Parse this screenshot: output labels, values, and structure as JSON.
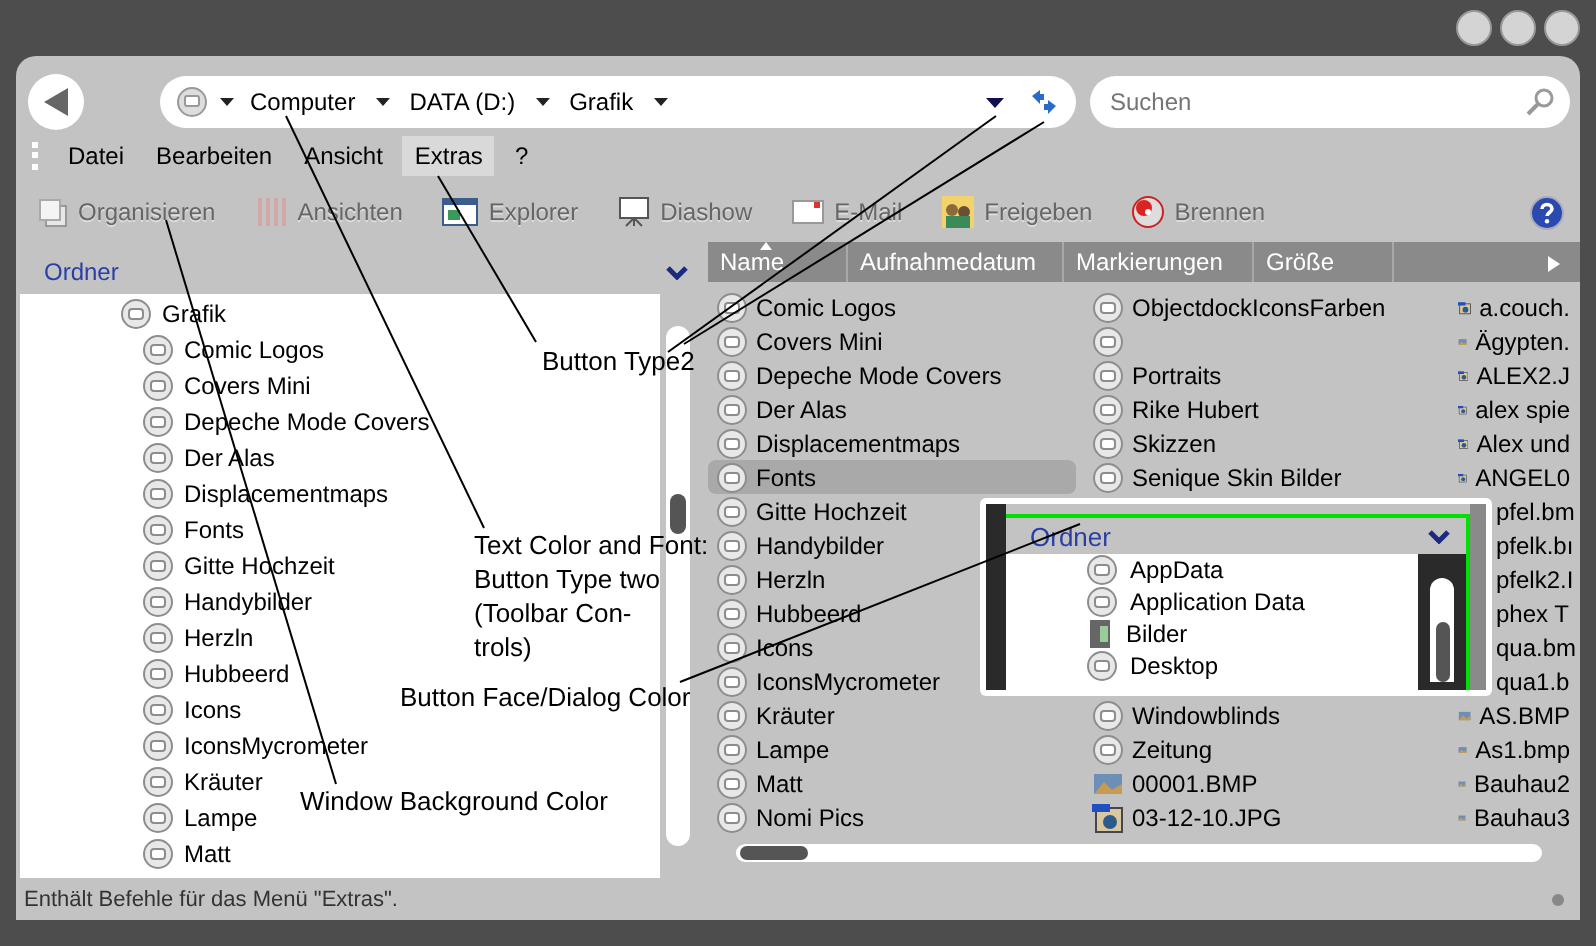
{
  "address_bar": {
    "breadcrumbs": [
      "Computer",
      "DATA (D:)",
      "Grafik"
    ]
  },
  "search": {
    "placeholder": "Suchen"
  },
  "menu": [
    {
      "label": "Datei",
      "selected": false
    },
    {
      "label": "Bearbeiten",
      "selected": false
    },
    {
      "label": "Ansicht",
      "selected": false
    },
    {
      "label": "Extras",
      "selected": true
    },
    {
      "label": "?",
      "selected": false
    }
  ],
  "toolbar": [
    {
      "label": "Organisieren",
      "kind": "organize",
      "disabled": true
    },
    {
      "label": "Ansichten",
      "kind": "views",
      "disabled": true
    },
    {
      "label": "Explorer",
      "kind": "explorer",
      "disabled": true
    },
    {
      "label": "Diashow",
      "kind": "slideshow",
      "disabled": true
    },
    {
      "label": "E-Mail",
      "kind": "email",
      "disabled": true
    },
    {
      "label": "Freigeben",
      "kind": "share",
      "disabled": true
    },
    {
      "label": "Brennen",
      "kind": "burn",
      "disabled": true
    }
  ],
  "folder_pane": {
    "title": "Ordner",
    "tree": [
      {
        "label": "Grafik",
        "children": [
          {
            "label": "Comic Logos"
          },
          {
            "label": "Covers Mini"
          },
          {
            "label": "Depeche Mode Covers"
          },
          {
            "label": "Der Alas"
          },
          {
            "label": "Displacementmaps"
          },
          {
            "label": "Fonts"
          },
          {
            "label": "Gitte Hochzeit"
          },
          {
            "label": "Handybilder"
          },
          {
            "label": "Herzln"
          },
          {
            "label": "Hubbeerd"
          },
          {
            "label": "Icons"
          },
          {
            "label": "IconsMycrometer"
          },
          {
            "label": "Kräuter"
          },
          {
            "label": "Lampe"
          },
          {
            "label": "Matt"
          }
        ]
      }
    ]
  },
  "file_list": {
    "columns": [
      {
        "label": "Name",
        "sorted": true
      },
      {
        "label": "Aufnahmedatum",
        "sorted": false
      },
      {
        "label": "Markierungen",
        "sorted": false
      },
      {
        "label": "Größe",
        "sorted": false
      }
    ],
    "list_columns": [
      {
        "items": [
          {
            "kind": "folder",
            "label": "Comic Logos",
            "selected": false
          },
          {
            "kind": "folder",
            "label": "Covers Mini",
            "selected": false
          },
          {
            "kind": "folder",
            "label": "Depeche Mode Covers",
            "selected": false
          },
          {
            "kind": "folder",
            "label": "Der Alas",
            "selected": false
          },
          {
            "kind": "folder",
            "label": "Displacementmaps",
            "selected": false
          },
          {
            "kind": "folder",
            "label": "Fonts",
            "selected": true
          },
          {
            "kind": "folder",
            "label": "Gitte Hochzeit",
            "selected": false
          },
          {
            "kind": "folder",
            "label": "Handybilder",
            "selected": false
          },
          {
            "kind": "folder",
            "label": "Herzln",
            "selected": false
          },
          {
            "kind": "folder",
            "label": "Hubbeerd",
            "selected": false
          },
          {
            "kind": "folder",
            "label": "Icons",
            "selected": false
          },
          {
            "kind": "folder",
            "label": "IconsMycrometer",
            "selected": false
          },
          {
            "kind": "folder",
            "label": "Kräuter",
            "selected": false
          },
          {
            "kind": "folder",
            "label": "Lampe",
            "selected": false
          },
          {
            "kind": "folder",
            "label": "Matt",
            "selected": false
          },
          {
            "kind": "folder",
            "label": "Nomi Pics",
            "selected": false
          }
        ]
      },
      {
        "items": [
          {
            "kind": "folder",
            "label": "ObjectdockIconsFarben",
            "selected": false
          },
          {
            "kind": "folder",
            "selected": false
          },
          {
            "kind": "folder",
            "label": "Portraits",
            "selected": false
          },
          {
            "kind": "folder",
            "label": "Rike Hubert",
            "selected": false
          },
          {
            "kind": "folder",
            "label": "Skizzen",
            "selected": false
          },
          {
            "kind": "folder",
            "label": "Senique Skin Bilder",
            "selected": false
          },
          {
            "kind": "hidden"
          },
          {
            "kind": "hidden"
          },
          {
            "kind": "hidden"
          },
          {
            "kind": "hidden"
          },
          {
            "kind": "hidden"
          },
          {
            "kind": "hidden"
          },
          {
            "kind": "folder",
            "label": "Windowblinds",
            "selected": false
          },
          {
            "kind": "folder",
            "label": "Zeitung",
            "selected": false
          },
          {
            "kind": "image",
            "label": "00001.BMP",
            "selected": false
          },
          {
            "kind": "photo",
            "label": "03-12-10.JPG",
            "selected": false
          }
        ]
      },
      {
        "items": [
          {
            "kind": "photo",
            "label": "a.couch.",
            "selected": false
          },
          {
            "kind": "image",
            "label": "Ägypten.",
            "selected": false
          },
          {
            "kind": "photo",
            "label": "ALEX2.J",
            "selected": false
          },
          {
            "kind": "photo",
            "label": "alex spie",
            "selected": false
          },
          {
            "kind": "photo",
            "label": "Alex und",
            "selected": false
          },
          {
            "kind": "photo",
            "label": "ANGEL0",
            "selected": false
          },
          {
            "kind": "partial",
            "label": "pfel.bm",
            "selected": false
          },
          {
            "kind": "partial",
            "label": "pfelk.bı",
            "selected": false
          },
          {
            "kind": "partial",
            "label": "pfelk2.I",
            "selected": false
          },
          {
            "kind": "partial",
            "label": "phex T",
            "selected": false
          },
          {
            "kind": "partial",
            "label": "qua.bm",
            "selected": false
          },
          {
            "kind": "partial",
            "label": "qua1.b",
            "selected": false
          },
          {
            "kind": "image",
            "label": "AS.BMP",
            "selected": false
          },
          {
            "kind": "image",
            "label": "As1.bmp",
            "selected": false
          },
          {
            "kind": "image",
            "label": "Bauhau2",
            "selected": false
          },
          {
            "kind": "image",
            "label": "Bauhau3",
            "selected": false
          }
        ]
      }
    ]
  },
  "inset": {
    "title": "Ordner",
    "items": [
      {
        "label": "AppData",
        "kind": "folder"
      },
      {
        "label": "Application Data",
        "kind": "folder"
      },
      {
        "label": "Bilder",
        "kind": "library"
      },
      {
        "label": "Desktop",
        "kind": "folder"
      }
    ]
  },
  "status_bar": "Enthält Befehle für das Menü \"Extras\".",
  "annotations": [
    {
      "lines": [
        "Button Type2"
      ]
    },
    {
      "lines": [
        "Text Color and Font:",
        "Button Type two",
        "(Toolbar Con-",
        "trols)"
      ]
    },
    {
      "lines": [
        "Window Background Color"
      ]
    },
    {
      "lines": [
        "Button Face/Dialog Color"
      ]
    }
  ]
}
